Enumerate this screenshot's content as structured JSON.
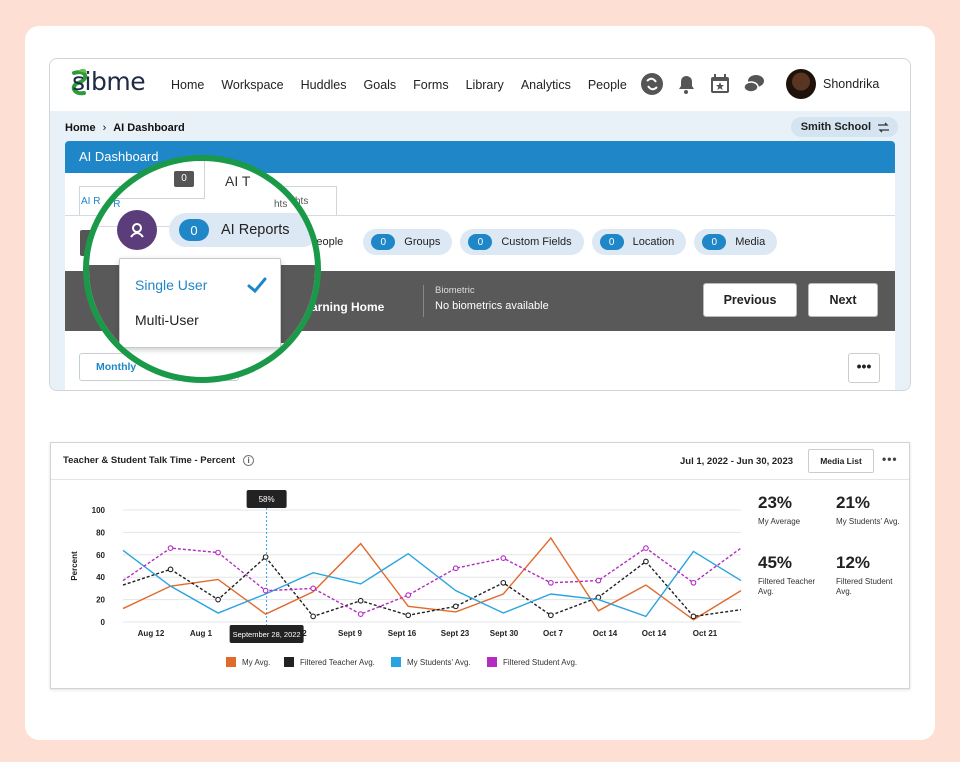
{
  "nav": {
    "logo": "sibme",
    "menu": [
      "Home",
      "Workspace",
      "Huddles",
      "Goals",
      "Forms",
      "Library",
      "Analytics",
      "People"
    ],
    "user_name": "Shondrika"
  },
  "breadcrumb": {
    "home": "Home",
    "current": "AI Dashboard"
  },
  "school": "Smith School",
  "dashboard": {
    "title": "AI Dashboard",
    "tab_small_a": "AI R",
    "tab_small_b": "hts",
    "chips": [
      {
        "label": "People",
        "count": null
      },
      {
        "label": "Groups",
        "count": "0"
      },
      {
        "label": "Custom Fields",
        "count": "0"
      },
      {
        "label": "Location",
        "count": "0"
      },
      {
        "label": "Media",
        "count": "0"
      }
    ],
    "grey_bar": {
      "initial": "N",
      "frame_label": "me",
      "frame_value": "Learning Home",
      "biometric_label": "Biometric",
      "biometric_value": "No biometrics available"
    },
    "previous": "Previous",
    "next": "Next",
    "period": "Monthly",
    "more": "•••"
  },
  "magnifier": {
    "tab1_label": "ts",
    "tab1_count": "0",
    "tab2_label": "AI T",
    "reports_count": "0",
    "reports_label": "AI Reports",
    "options": [
      "Single User",
      "Multi-User"
    ],
    "selected": "Single User"
  },
  "chart_card": {
    "title": "Teacher & Student Talk Time - Percent",
    "date_range": "Jul 1, 2022 - Jun 30, 2023",
    "media_list": "Media List",
    "more": "•••",
    "tooltip_value": "58%",
    "tooltip_date": "September 28, 2022",
    "stats": [
      {
        "value": "23%",
        "label": "My Average"
      },
      {
        "value": "21%",
        "label": "My Students' Avg."
      },
      {
        "value": "45%",
        "label": "Filtered Teacher Avg."
      },
      {
        "value": "12%",
        "label": "Filtered Student Avg."
      }
    ]
  },
  "chart_data": {
    "type": "line",
    "ylabel": "Percent",
    "xlabel": "",
    "ylim": [
      0,
      100
    ],
    "yticks": [
      0,
      20,
      40,
      60,
      80,
      100
    ],
    "tick_labels": [
      "Aug 12",
      "Aug 1",
      "t 2",
      "Sept 9",
      "Sept 16",
      "Sept 23",
      "Sept 30",
      "Oct 7",
      "Oct 14",
      "Oct 14",
      "Oct 21"
    ],
    "grid": true,
    "legend_placement": "bottom",
    "series": [
      {
        "name": "My Avg.",
        "color": "#e06a2c",
        "dashed": false,
        "markers": false,
        "values": [
          12,
          32,
          38,
          7,
          27,
          70,
          14,
          9,
          25,
          75,
          10,
          33,
          2,
          28
        ]
      },
      {
        "name": "Filtered Teacher Avg.",
        "color": "#222222",
        "dashed": true,
        "markers": true,
        "values": [
          33,
          47,
          20,
          58,
          5,
          19,
          6,
          14,
          35,
          6,
          22,
          54,
          5,
          11
        ]
      },
      {
        "name": "My Students' Avg.",
        "color": "#2aa4e0",
        "dashed": false,
        "markers": false,
        "values": [
          64,
          32,
          8,
          25,
          44,
          34,
          61,
          28,
          8,
          25,
          20,
          5,
          63,
          37
        ]
      },
      {
        "name": "Filtered Student Avg.",
        "color": "#b42bc2",
        "dashed": true,
        "markers": true,
        "values": [
          37,
          66,
          62,
          28,
          30,
          7,
          24,
          48,
          57,
          35,
          37,
          66,
          35,
          66
        ]
      }
    ]
  }
}
